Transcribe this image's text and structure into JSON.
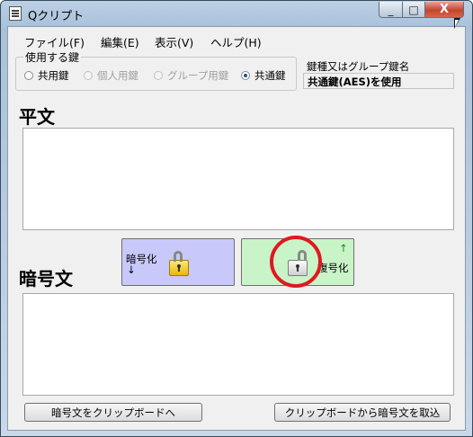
{
  "window": {
    "title": "Qクリプト",
    "minimize_glyph": "_",
    "maximize_glyph": "□",
    "close_glyph": "X"
  },
  "menu": [
    {
      "label": "ファイル(F)"
    },
    {
      "label": "編集(E)"
    },
    {
      "label": "表示(V)"
    },
    {
      "label": "ヘルプ(H)"
    }
  ],
  "key_group": {
    "label": "使用する鍵",
    "options": [
      {
        "label": "共用鍵",
        "enabled": true,
        "checked": false
      },
      {
        "label": "個人用鍵",
        "enabled": false,
        "checked": false
      },
      {
        "label": "グループ用鍵",
        "enabled": false,
        "checked": false
      },
      {
        "label": "共通鍵",
        "enabled": true,
        "checked": true
      }
    ]
  },
  "key_info": {
    "label": "鍵種又はグループ鍵名",
    "value": "共通鍵(AES)を使用"
  },
  "plaintext": {
    "heading": "平文",
    "value": ""
  },
  "ciphertext": {
    "heading": "暗号文",
    "value": ""
  },
  "encrypt_button": {
    "label": "暗号化",
    "arrow": "↓",
    "icon": "closed-lock-icon"
  },
  "decrypt_button": {
    "label": "復号化",
    "arrow": "↑",
    "icon": "open-lock-icon"
  },
  "highlight": {
    "target": "decrypt_button",
    "color": "#e01820"
  },
  "bottom_buttons": {
    "copy_to_clipboard": "暗号文をクリップボードへ",
    "import_from_clipboard": "クリップボードから暗号文を取込"
  }
}
